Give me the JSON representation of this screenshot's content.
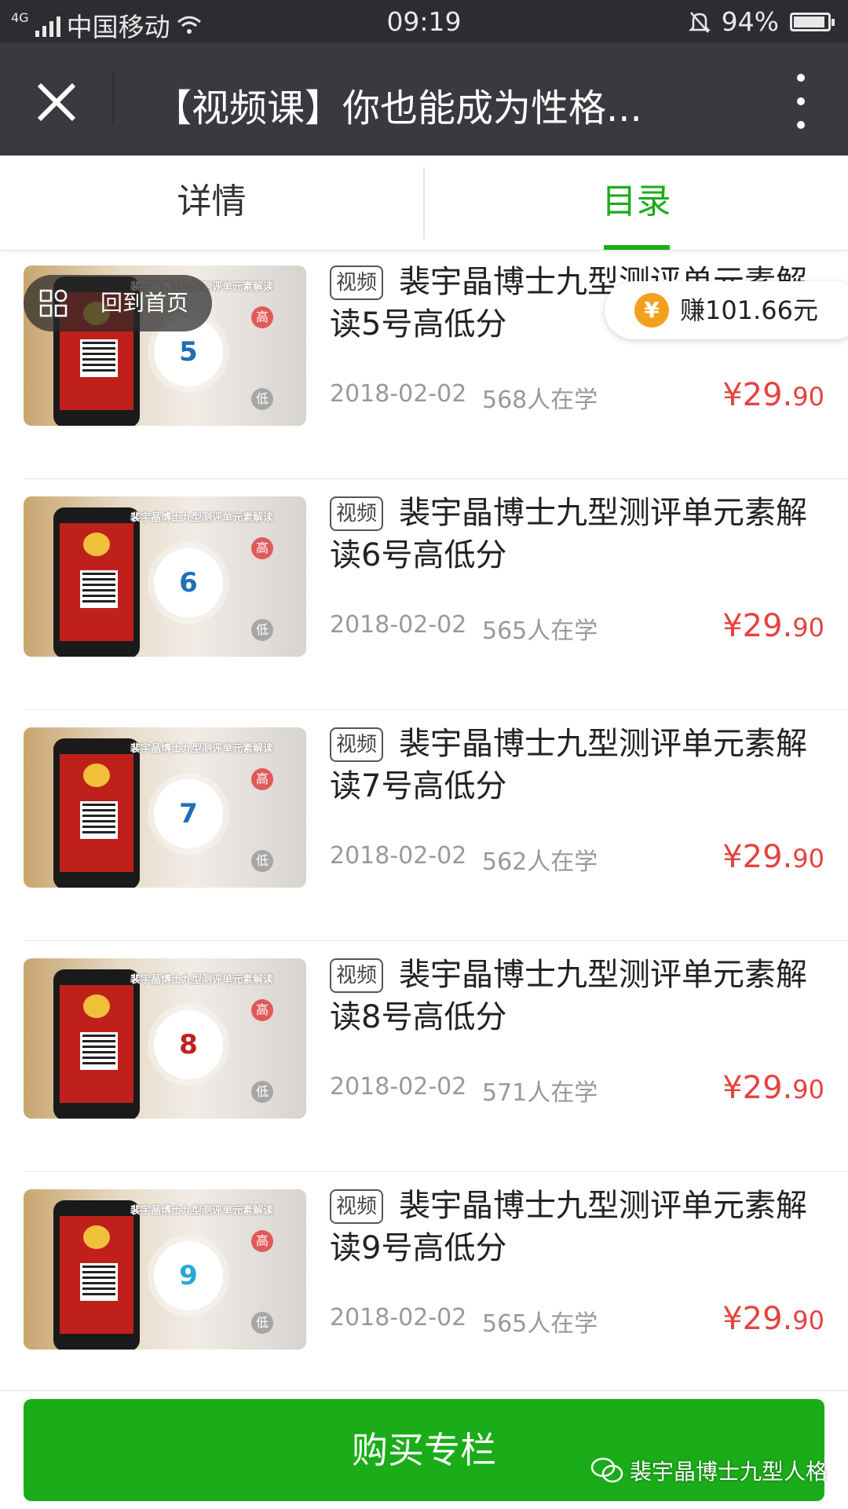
{
  "status_bar": {
    "network": "4G",
    "carrier": "中国移动",
    "time": "09:19",
    "battery": "94%",
    "battery_level": 0.94
  },
  "header": {
    "title": "【视频课】你也能成为性格..."
  },
  "tabs": [
    {
      "label": "详情",
      "active": false
    },
    {
      "label": "目录",
      "active": true
    }
  ],
  "floating": {
    "home_label": "回到首页",
    "earn_label": "赚101.66元",
    "coin_symbol": "¥"
  },
  "items": [
    {
      "tag": "视频",
      "title": "裴宇晶博士九型测评单元素解读5号高低分",
      "number": "5",
      "number_color": "#1f6fb8",
      "date": "2018-02-02",
      "learners": "568人在学",
      "price_main": "¥29.",
      "price_cents": "90"
    },
    {
      "tag": "视频",
      "title": "裴宇晶博士九型测评单元素解读6号高低分",
      "number": "6",
      "number_color": "#1f6fb8",
      "date": "2018-02-02",
      "learners": "565人在学",
      "price_main": "¥29.",
      "price_cents": "90"
    },
    {
      "tag": "视频",
      "title": "裴宇晶博士九型测评单元素解读7号高低分",
      "number": "7",
      "number_color": "#1f6fb8",
      "date": "2018-02-02",
      "learners": "562人在学",
      "price_main": "¥29.",
      "price_cents": "90"
    },
    {
      "tag": "视频",
      "title": "裴宇晶博士九型测评单元素解读8号高低分",
      "number": "8",
      "number_color": "#c0201c",
      "date": "2018-02-02",
      "learners": "571人在学",
      "price_main": "¥29.",
      "price_cents": "90"
    },
    {
      "tag": "视频",
      "title": "裴宇晶博士九型测评单元素解读9号高低分",
      "number": "9",
      "number_color": "#2aa7d8",
      "date": "2018-02-02",
      "learners": "565人在学",
      "price_main": "¥29.",
      "price_cents": "90"
    }
  ],
  "thumbnail": {
    "banner": "裴宇晶博士九型测评单元素解读",
    "high": "高",
    "low": "低"
  },
  "bottom": {
    "buy_label": "购买专栏"
  },
  "watermark": {
    "text": "裴宇晶博士九型人格"
  },
  "colors": {
    "accent": "#1aad19",
    "price": "#e64340",
    "titlebar": "#393a3f"
  }
}
